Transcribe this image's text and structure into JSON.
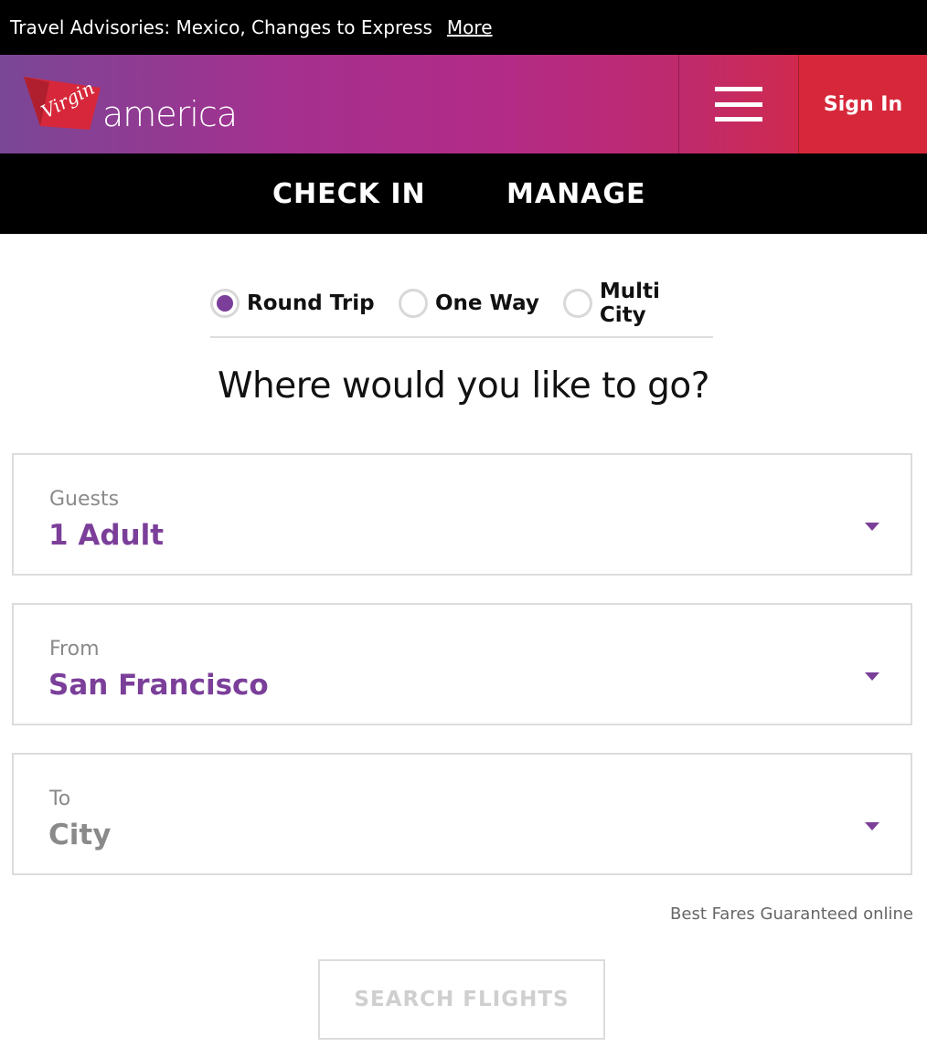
{
  "advisory": {
    "text": "Travel Advisories: Mexico, Changes to Express",
    "link_label": "More"
  },
  "header": {
    "logo_script": "Virgin",
    "logo_word": "america",
    "sign_in_label": "Sign In"
  },
  "nav": {
    "check_in_label": "CHECK IN",
    "manage_label": "MANAGE"
  },
  "trip_types": {
    "selected": "Round Trip",
    "options": [
      "Round Trip",
      "One Way",
      "Multi City"
    ]
  },
  "headline": "Where would you like to go?",
  "fields": {
    "guests": {
      "label": "Guests",
      "value": "1 Adult"
    },
    "from": {
      "label": "From",
      "value": "San Francisco"
    },
    "to": {
      "label": "To",
      "placeholder": "City"
    }
  },
  "best_fares_text": "Best Fares Guaranteed online",
  "search_button_label": "SEARCH FLIGHTS",
  "colors": {
    "brand_purple": "#7b3f9a",
    "brand_red": "#d6283a",
    "bar_black": "#000000"
  },
  "icons": [
    "hamburger-menu-icon",
    "chevron-down-icon",
    "virgin-logo-icon"
  ]
}
